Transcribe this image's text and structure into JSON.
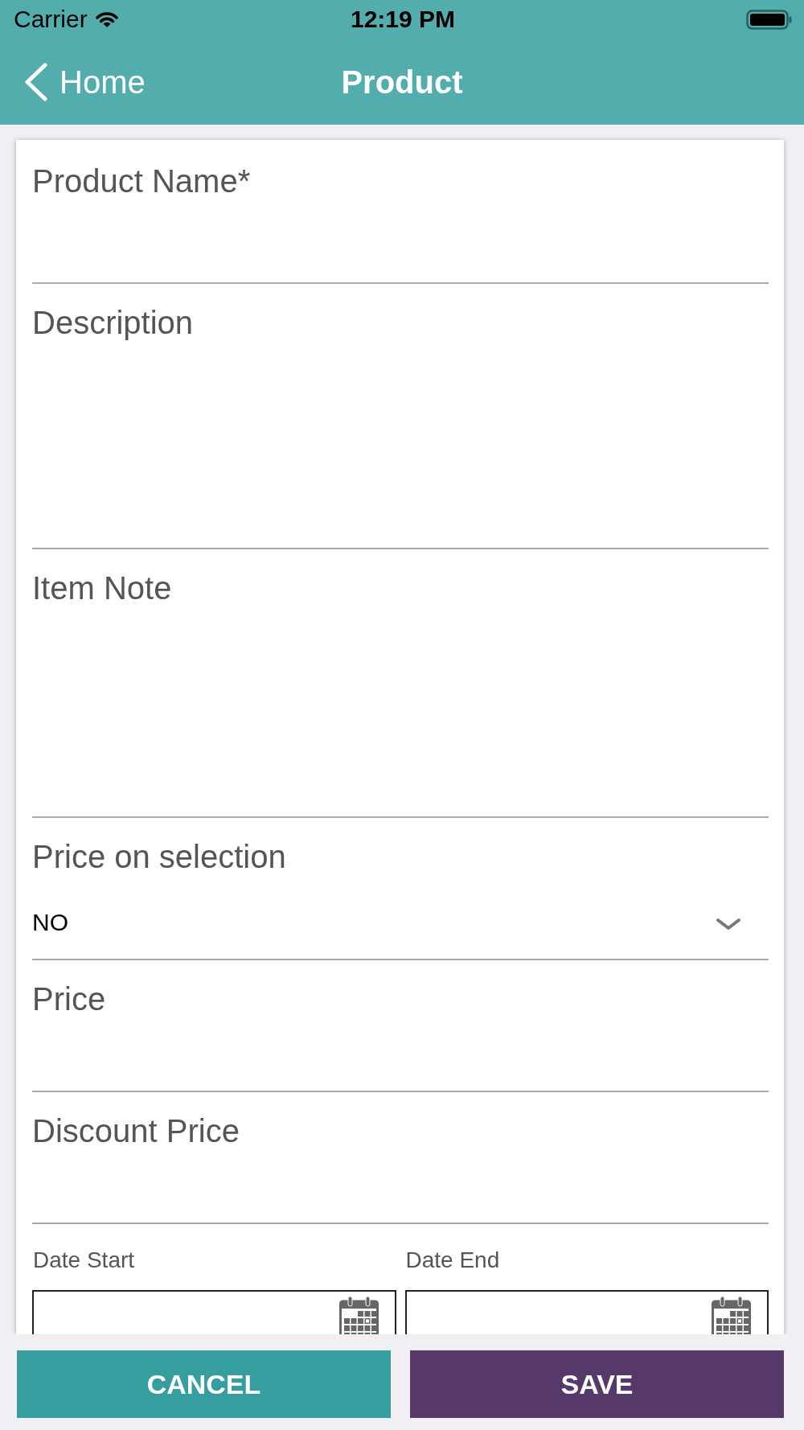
{
  "status_bar": {
    "carrier": "Carrier",
    "time": "12:19 PM"
  },
  "nav": {
    "back": "Home",
    "title": "Product"
  },
  "form": {
    "fields": [
      {
        "kind": "text",
        "label": "Product Name*"
      },
      {
        "kind": "textarea",
        "label": "Description"
      },
      {
        "kind": "textarea",
        "label": "Item Note"
      },
      {
        "kind": "select",
        "label": "Price on selection",
        "value": "NO"
      },
      {
        "kind": "text",
        "label": "Price"
      },
      {
        "kind": "text",
        "label": "Discount Price"
      }
    ],
    "dates": [
      {
        "label": "Date Start"
      },
      {
        "label": "Date End"
      }
    ]
  },
  "buttons": [
    {
      "kind": "cancel",
      "label": "CANCEL"
    },
    {
      "kind": "save",
      "label": "SAVE"
    }
  ]
}
